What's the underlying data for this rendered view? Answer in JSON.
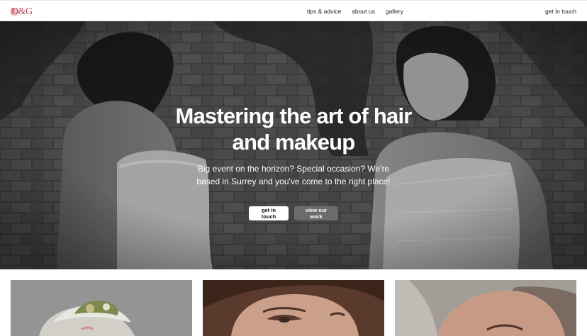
{
  "nav": {
    "logo_text": "D&G",
    "links": [
      "tips & advice",
      "about us",
      "gallery"
    ],
    "cta": "get in touch"
  },
  "hero": {
    "title_line1": "Mastering the art of hair",
    "title_line2": "and makeup",
    "subtitle": "Big event on the horizon? Special occasion? We're based in Surrey and you've come to the right place!",
    "primary_button": "get in touch",
    "secondary_button": "view our work"
  },
  "colors": {
    "accent_logo": "#b5465a",
    "secondary_button_bg": "#6b6b6b"
  }
}
